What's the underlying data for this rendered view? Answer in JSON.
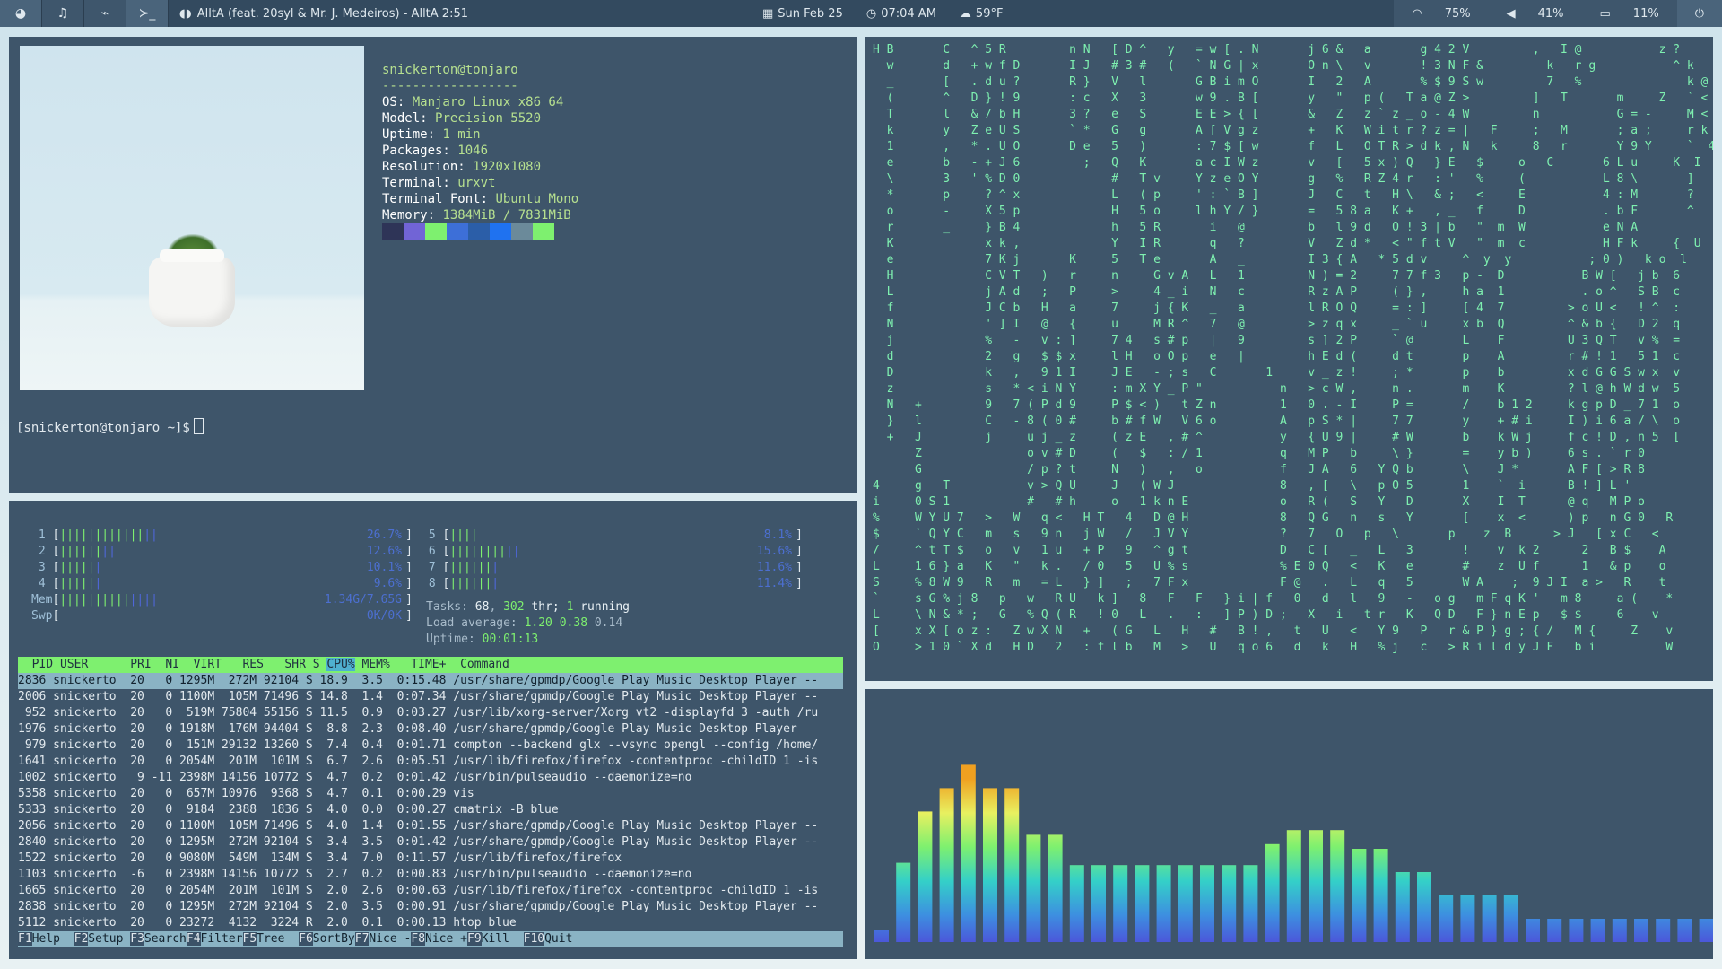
{
  "bar": {
    "workspaces": [
      "◕",
      "♫",
      "⌁",
      "≻_"
    ],
    "now_playing": "AlltA (feat. 20syl & Mr. J. Medeiros) - AlltA  2:51",
    "date": "Sun Feb 25",
    "time": "07:04 AM",
    "weather": "59°F",
    "wifi": "75%",
    "volume": "41%",
    "battery": "11%"
  },
  "neofetch": {
    "user": "snickerton@tonjaro",
    "sep": "------------------",
    "fields": [
      {
        "k": "OS: ",
        "v": "Manjaro Linux x86_64"
      },
      {
        "k": "Model: ",
        "v": "Precision 5520"
      },
      {
        "k": "Uptime: ",
        "v": "1 min"
      },
      {
        "k": "Packages: ",
        "v": "1046"
      },
      {
        "k": "Resolution: ",
        "v": "1920x1080"
      },
      {
        "k": "Terminal: ",
        "v": "urxvt"
      },
      {
        "k": "Terminal Font: ",
        "v": "Ubuntu Mono"
      },
      {
        "k": "Memory: ",
        "v": "1384MiB / 7831MiB"
      }
    ],
    "swatches": [
      "#2e3457",
      "#7164d6",
      "#7ef06f",
      "#3d6fd8",
      "#2b5ea8",
      "#1f72f0",
      "#6b8a9a",
      "#7ef06f"
    ],
    "prompt": "[snickerton@tonjaro ~]$"
  },
  "htop": {
    "cpus": [
      {
        "n": "1",
        "g": "||||||||||||",
        "b": "||",
        "pct": "26.7%"
      },
      {
        "n": "2",
        "g": "||||||",
        "b": "||",
        "pct": "12.6%"
      },
      {
        "n": "3",
        "g": "|||||",
        "b": "|",
        "pct": "10.1%"
      },
      {
        "n": "4",
        "g": "|||||",
        "b": "|",
        "pct": "9.6%"
      },
      {
        "n": "5",
        "g": "||||",
        "b": "",
        "pct": "8.1%"
      },
      {
        "n": "6",
        "g": "||||||||",
        "b": "||",
        "pct": "15.6%"
      },
      {
        "n": "7",
        "g": "||||||",
        "b": "|",
        "pct": "11.6%"
      },
      {
        "n": "8",
        "g": "||||||",
        "b": "|",
        "pct": "11.4%"
      }
    ],
    "mem": {
      "label": "Mem",
      "g": "||||||||||",
      "b": "||||",
      "val": "1.34G/7.65G"
    },
    "swp": {
      "label": "Swp",
      "val": "0K/0K"
    },
    "tasks": {
      "label": "Tasks: ",
      "count": "68",
      "thr": "302",
      "thr_label": " thr; ",
      "running": "1",
      "running_label": " running"
    },
    "load": {
      "label": "Load average: ",
      "v1": "1.20",
      "v2": "0.38",
      "v3": "0.14"
    },
    "uptime": {
      "label": "Uptime: ",
      "v": "00:01:13"
    },
    "header": {
      "pre": "  PID USER      PRI  NI  VIRT   RES   SHR S ",
      "sort": "CPU%",
      "post": " MEM%   TIME+  Command"
    },
    "rows": [
      "2836 snickerto  20   0 1295M  272M 92104 S 18.9  3.5  0:15.48 /usr/share/gpmdp/Google Play Music Desktop Player --",
      "2006 snickerto  20   0 1100M  105M 71496 S 14.8  1.4  0:07.34 /usr/share/gpmdp/Google Play Music Desktop Player --",
      " 952 snickerto  20   0  519M 75804 55156 S 11.5  0.9  0:03.27 /usr/lib/xorg-server/Xorg vt2 -displayfd 3 -auth /ru",
      "1976 snickerto  20   0 1918M  176M 94404 S  8.8  2.3  0:08.40 /usr/share/gpmdp/Google Play Music Desktop Player",
      " 979 snickerto  20   0  151M 29132 13260 S  7.4  0.4  0:01.71 compton --backend glx --vsync opengl --config /home/",
      "1641 snickerto  20   0 2054M  201M  101M S  6.7  2.6  0:05.51 /usr/lib/firefox/firefox -contentproc -childID 1 -is",
      "1002 snickerto   9 -11 2398M 14156 10772 S  4.7  0.2  0:01.42 /usr/bin/pulseaudio --daemonize=no",
      "5358 snickerto  20   0  657M 10976  9368 S  4.7  0.1  0:00.29 vis",
      "5333 snickerto  20   0  9184  2388  1836 S  4.0  0.0  0:00.27 cmatrix -B blue",
      "2056 snickerto  20   0 1100M  105M 71496 S  4.0  1.4  0:01.55 /usr/share/gpmdp/Google Play Music Desktop Player --",
      "2840 snickerto  20   0 1295M  272M 92104 S  3.4  3.5  0:01.42 /usr/share/gpmdp/Google Play Music Desktop Player --",
      "1522 snickerto  20   0 9080M  549M  134M S  3.4  7.0  0:11.57 /usr/lib/firefox/firefox",
      "1103 snickerto  -6   0 2398M 14156 10772 S  2.7  0.2  0:00.83 /usr/bin/pulseaudio --daemonize=no",
      "1665 snickerto  20   0 2054M  201M  101M S  2.0  2.6  0:00.63 /usr/lib/firefox/firefox -contentproc -childID 1 -is",
      "2838 snickerto  20   0 1295M  272M 92104 S  2.0  3.5  0:00.91 /usr/share/gpmdp/Google Play Music Desktop Player --",
      "5112 snickerto  20   0 23272  4132  3224 R  2.0  0.1  0:00.13 htop blue"
    ],
    "footer": [
      {
        "k": "F1",
        "v": "Help  "
      },
      {
        "k": "F2",
        "v": "Setup "
      },
      {
        "k": "F3",
        "v": "Search"
      },
      {
        "k": "F4",
        "v": "Filter"
      },
      {
        "k": "F5",
        "v": "Tree  "
      },
      {
        "k": "F6",
        "v": "SortBy"
      },
      {
        "k": "F7",
        "v": "Nice -"
      },
      {
        "k": "F8",
        "v": "Nice +"
      },
      {
        "k": "F9",
        "v": "Kill  "
      },
      {
        "k": "F10",
        "v": "Quit"
      }
    ]
  },
  "matrix_lines": [
    "H B       C   ^ 5 R         n N   [ D ^   y   = w [ . N       j 6 &   a       g 4 2 V         ,   I @           z ?",
    "  w       d   + w f D       I J   # 3 #   (   ` N G | x       O n \\   v       ! 3 N F &         k   r g           ^ k",
    "  _       [   . d u ?       R }   V   l       G B i m O       I   2   A       % $ 9 S w         7   %               k @",
    "  (       ^   D } ! 9       : c   X   3       w 9 . B [       y   \"   p (   T a @ Z >         ]   T       m     Z   ` <",
    "  T       l   & / b H       3 ?   e   S       E E > { [       &   Z   z ` z _ o - 4 W         n           G = -     M <",
    "  k       y   Z e U S       ` *   G   g       A [ V g z       +   K   W i t r ? z = |   F     ;   M       ; a ;     r k",
    "  1       ,   * . U O       D e   5   )       : 7 $ [ w       f   L   O T R > d k , N   k     8   r       Y 9 Y     `  4",
    "  e       b   - + J 6         ;   Q   K       a c I W z       v   [   5 x ) Q   } E   $     o   C       6 L u     K  I",
    "  \\       3   ' % D 0             #   T v     Y z e O Y       g   %   R Z 4 r   : '   %     (           L 8 \\       ]",
    "  *       p     ? ^ x             L   ( p     ' : ` B ]       J   C   t   H \\   & ;   <     E           4 : M       ?",
    "  o       -     X 5 p             H   5 o     l h Y / }       =   5 8 a   K +   , _   f     D           . b F       ^",
    "  r       _     } B 4             h   5 R       i   @         b   l 9 d   O ! 3 | b   \"  m  W           e N A",
    "  K             x k ,             Y   I R       q   ?         V   Z d *   < \" f t V   \"  m  c           H F k     {  U",
    "  e             7 K j       K     5   T e       A   _         I 3 { A   * 5 d v     ^  y  y           ; 0 )   k o  l",
    "  H             C V T   )   r     n     G v A   L   1         N ) = 2     7 7 f 3   p -  D           B W [   j b  6",
    "  L             j A d   ;   P     >     4 _ i   N   c         R z A P     ( } ,     h a  1           . o ^   S B  c",
    "  f             J C b   H   a     7     j { K   _   a         l R O Q     = : ]     [ 4  7         > o U <   ! ^  :",
    "  N             ' ] I   @   {     u     M R ^   7   @         > z q x     _ ` u     x b  Q         ^ & b {   D 2  q",
    "  j             %   -   v : ]     7 4   s # p   |   9         s ] 2 P     ` @       L    F         U 3 Q T   v %  =",
    "  d             2   g   $ $ x     l H   o O p   e   |         h E d (     d t       p    A         r # ! 1   5 1  c",
    "  D             k   ,   9 1 I     J E   - ; s   C       1     v _ z !     ; *       p    b         x d G G S w x  v",
    "  z             s   * < i N Y     : m X Y _ P \"           n   > c W ,     n .       m    K         ? l @ h W d w  5",
    "  N   +         9   7 ( P d 9     P $ < )   t Z n         1   0 . - I     P =       /    b 1 2     k g p D _ 7 1  o",
    "  }   l         C   - 8 ( 0 #     b # f W   V 6 o         A   p S * |     7 7       y    + # i     I ) i 6 a / \\  o",
    "  +   J         j     u j _ z     ( z E   , # ^           y   { U 9 |     # W       b    k W j     f c ! D , n 5  [",
    "      Z               o v # D     (   $   : / 1           q   M P   b     \\ }       =    y b )     6 s . ` r 0",
    "      G               / p ? t     N   )   ,   o           f   J A   6   Y Q b       \\    J *       A F [ > R 8",
    "4     g   T           v > Q U     J   ( W J               8   , [   \\   p O 5       1    `  i      B ! ] L '",
    "i     0 S 1           #   # h     o   1 k n E             o   R (   S   Y   D       X    I  T      @ q   M P o",
    "%     W Y U 7   >   W   q <   H T   4   D @ H             8   Q G   n   s   Y       [    x  <      ) p   n G 0   R",
    "$     ` Q Y C   m   s   9 n   j W   /   J V Y             ?   7   O   p   \\       p    z  B      > J   [ x C   <",
    "/     ^ t T $   o   v   1 u   + P   9   ^ g t             D   C [   _   L   3       !    v  k 2      2   B $    A",
    "L     1 6 } a   K   \"   k .   / 0   5   U % s             % E 0 Q   <   K   e       #    z  U f      1   & p    o",
    "S     % 8 W 9   R   m   = L   } ]   ;   7 F x             F @   .   L   q   5       W A    ;  9 J I  a >   R    t",
    "`     s G % j 8   p   w   R U   k ]   8   F   F   } i | f   0   d   l   9   -   o g   m F q K '   m 8     a (    *",
    "L     \\ N & * ;   G   % Q ( R   ! 0   L   .   :   ] P ) D ;   X   i   t r   K   Q D   F } n E p   $ $     6    v",
    "[     x X [ o z :   Z w X N   +   ( G   L   H   #   B ! ,   t   U   <   Y 9   P   r & P } g ; { /   M {     Z    v",
    "O     > 1 0 ` X d   H D   2   : f l b   M   >   U   q o 6   d   k   H   % j   c   > R i l d y J F   b i          W"
  ],
  "visualizer": {
    "levels": [
      0.05,
      0.34,
      0.56,
      0.66,
      0.76,
      0.66,
      0.66,
      0.46,
      0.46,
      0.33,
      0.33,
      0.33,
      0.33,
      0.33,
      0.33,
      0.33,
      0.33,
      0.33,
      0.42,
      0.48,
      0.48,
      0.48,
      0.4,
      0.4,
      0.3,
      0.3,
      0.2,
      0.2,
      0.2,
      0.2,
      0.1,
      0.1,
      0.1,
      0.1,
      0.1,
      0.1,
      0.1,
      0.1,
      0.1,
      0.1,
      0.1,
      0.1,
      0.1,
      0.1,
      0.1,
      0.1,
      0.1,
      0.1,
      0.1
    ],
    "gradient": [
      "#4f48d8",
      "#3d8fe0",
      "#34d0c8",
      "#7ef06f",
      "#e8f060",
      "#f0a020"
    ]
  }
}
